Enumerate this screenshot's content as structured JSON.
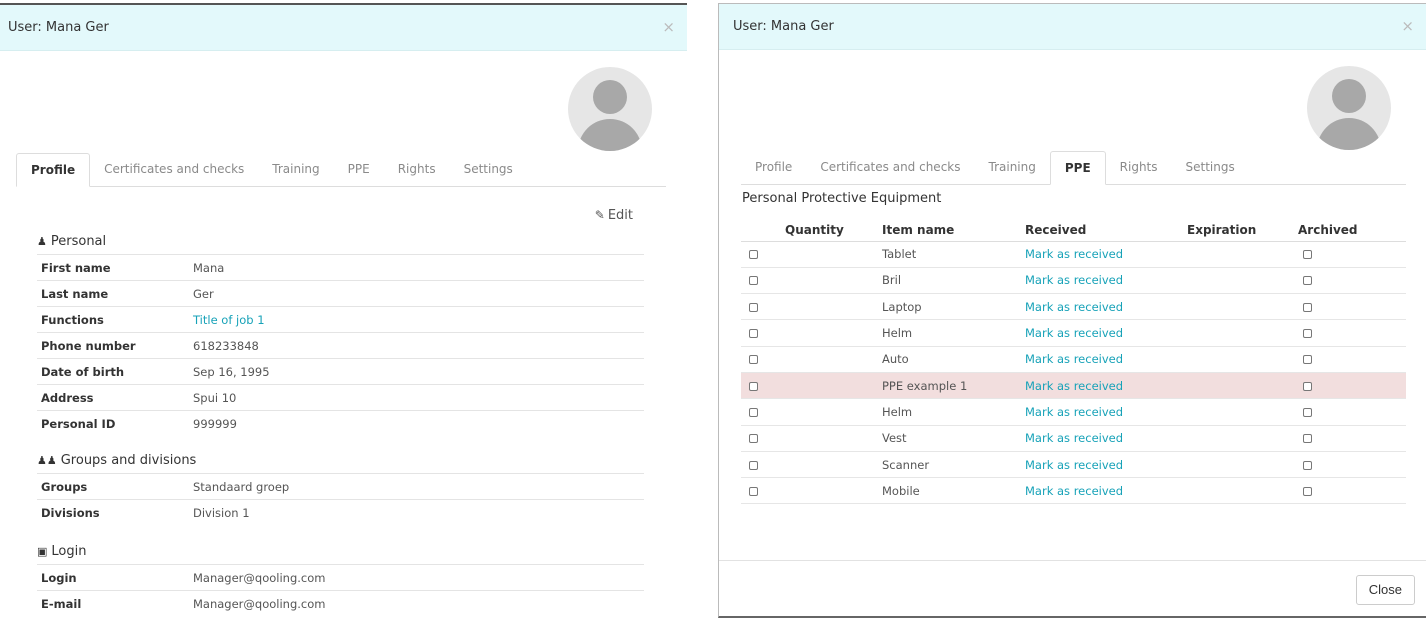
{
  "left_modal": {
    "title": "User: Mana Ger",
    "close_symbol": "×",
    "tabs": [
      "Profile",
      "Certificates and checks",
      "Training",
      "PPE",
      "Rights",
      "Settings"
    ],
    "active_tab": "Profile",
    "edit_label": "Edit",
    "edit_icon": "edit-icon",
    "personal": {
      "title": "Personal",
      "icon": "user-icon",
      "rows": [
        {
          "label": "First name",
          "value": "Mana"
        },
        {
          "label": "Last name",
          "value": "Ger"
        },
        {
          "label": "Functions",
          "value": "Title of job 1"
        },
        {
          "label": "Phone number",
          "value": "618233848"
        },
        {
          "label": "Date of birth",
          "value": "Sep 16, 1995"
        },
        {
          "label": "Address",
          "value": "Spui 10"
        },
        {
          "label": "Personal ID",
          "value": "999999"
        }
      ]
    },
    "groups": {
      "title": "Groups and divisions",
      "icon": "users-icon",
      "rows": [
        {
          "label": "Groups",
          "value": "Standaard groep"
        },
        {
          "label": "Divisions",
          "value": "Division 1"
        }
      ]
    },
    "login": {
      "title": "Login",
      "icon": "lock-icon",
      "rows": [
        {
          "label": "Login",
          "value": "Manager@qooling.com"
        },
        {
          "label": "E-mail",
          "value": "Manager@qooling.com"
        }
      ]
    }
  },
  "right_modal": {
    "title": "User: Mana Ger",
    "close_symbol": "×",
    "tabs": [
      "Profile",
      "Certificates and checks",
      "Training",
      "PPE",
      "Rights",
      "Settings"
    ],
    "active_tab": "PPE",
    "section_title": "Personal Protective Equipment",
    "columns": [
      "Quantity",
      "Item name",
      "Received",
      "Expiration",
      "Archived"
    ],
    "rows": [
      {
        "item": "Tablet",
        "received": "Mark as received",
        "highlight": false
      },
      {
        "item": "Bril",
        "received": "Mark as received",
        "highlight": false
      },
      {
        "item": "Laptop",
        "received": "Mark as received",
        "highlight": false
      },
      {
        "item": "Helm",
        "received": "Mark as received",
        "highlight": false
      },
      {
        "item": "Auto",
        "received": "Mark as received",
        "highlight": false
      },
      {
        "item": "PPE example 1",
        "received": "Mark as received",
        "highlight": true
      },
      {
        "item": "Helm",
        "received": "Mark as received",
        "highlight": false
      },
      {
        "item": "Vest",
        "received": "Mark as received",
        "highlight": false
      },
      {
        "item": "Scanner",
        "received": "Mark as received",
        "highlight": false
      },
      {
        "item": "Mobile",
        "received": "Mark as received",
        "highlight": false
      }
    ],
    "close_button": "Close"
  },
  "colors": {
    "header_bg": "#e3f9fb",
    "link": "#17a2b8",
    "highlight_row": "#f2dede"
  }
}
